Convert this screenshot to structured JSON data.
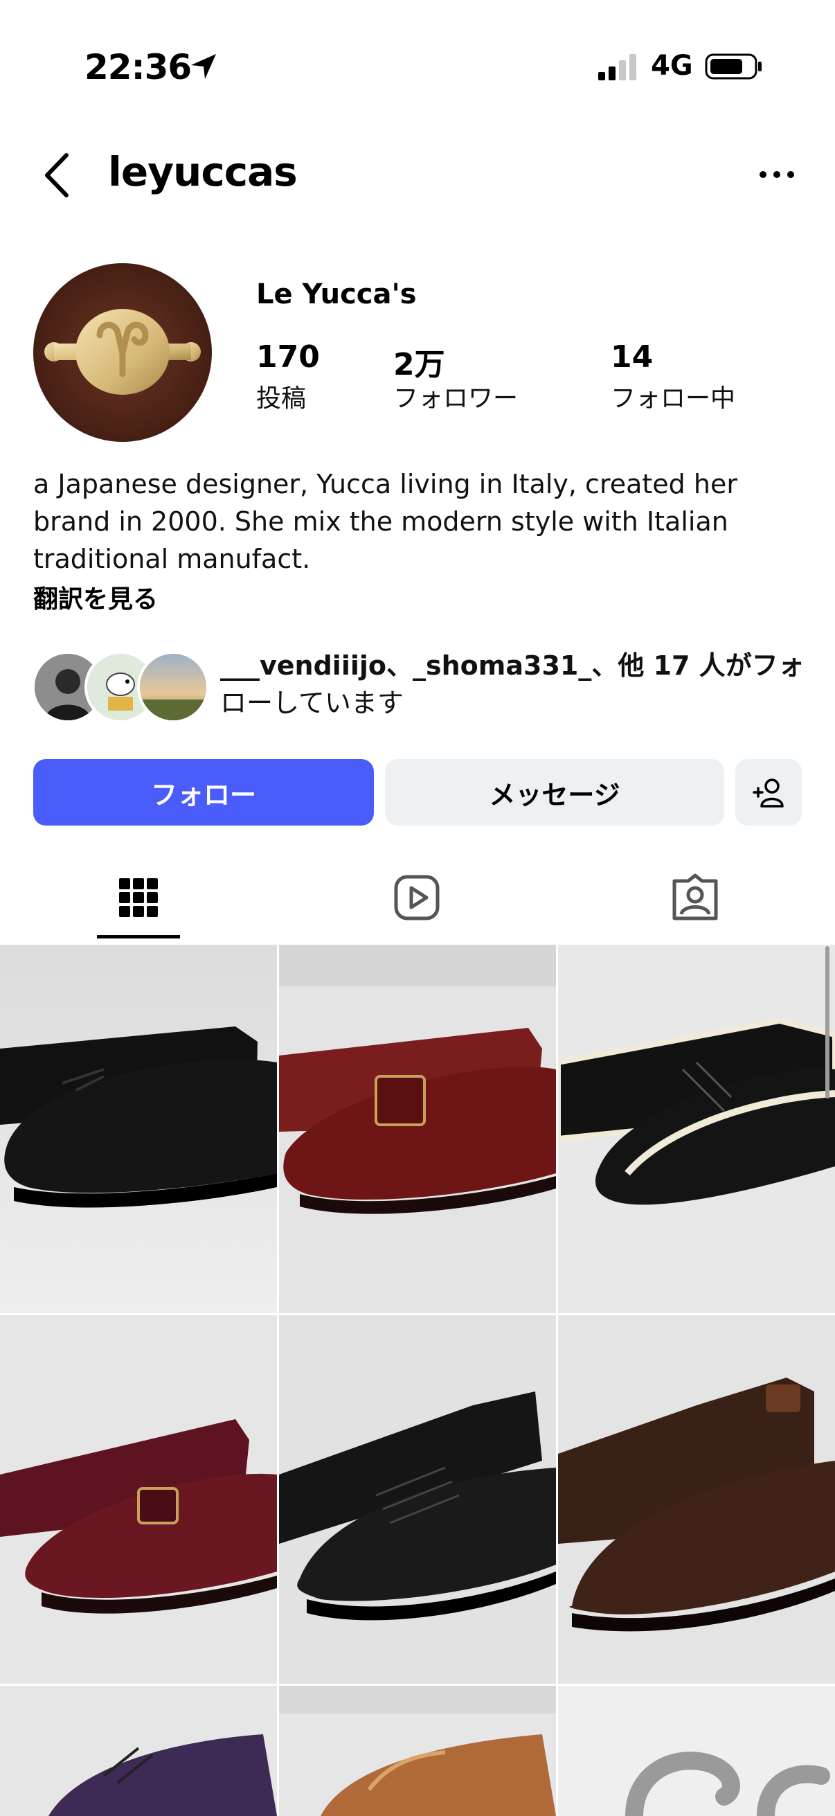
{
  "status_bar": {
    "time": "22:36",
    "network": "4G"
  },
  "header": {
    "username": "leyuccas"
  },
  "profile": {
    "display_name": "Le Yucca's",
    "stats": [
      {
        "value": "170",
        "label": "投稿"
      },
      {
        "value": "2万",
        "label": "フォロワー"
      },
      {
        "value": "14",
        "label": "フォロー中"
      }
    ],
    "bio_lines": [
      "a Japanese designer, Yucca living in Italy, created her",
      "brand in 2000. She mix the modern style with Italian",
      "traditional manufact."
    ],
    "translate_label": "翻訳を見る",
    "followed_by": {
      "names": "___vendiiijo、_shoma331_、他 17 人",
      "suffix_line1": "がフォ",
      "line2": "ローしています"
    }
  },
  "actions": {
    "follow_label": "フォロー",
    "message_label": "メッセージ"
  },
  "tabs": [
    {
      "icon": "grid-icon",
      "active": true
    },
    {
      "icon": "reels-icon",
      "active": false
    },
    {
      "icon": "tagged-icon",
      "active": false
    }
  ],
  "colors": {
    "follow_button": "#4a5dfb",
    "secondary_button": "#eef1f4"
  }
}
